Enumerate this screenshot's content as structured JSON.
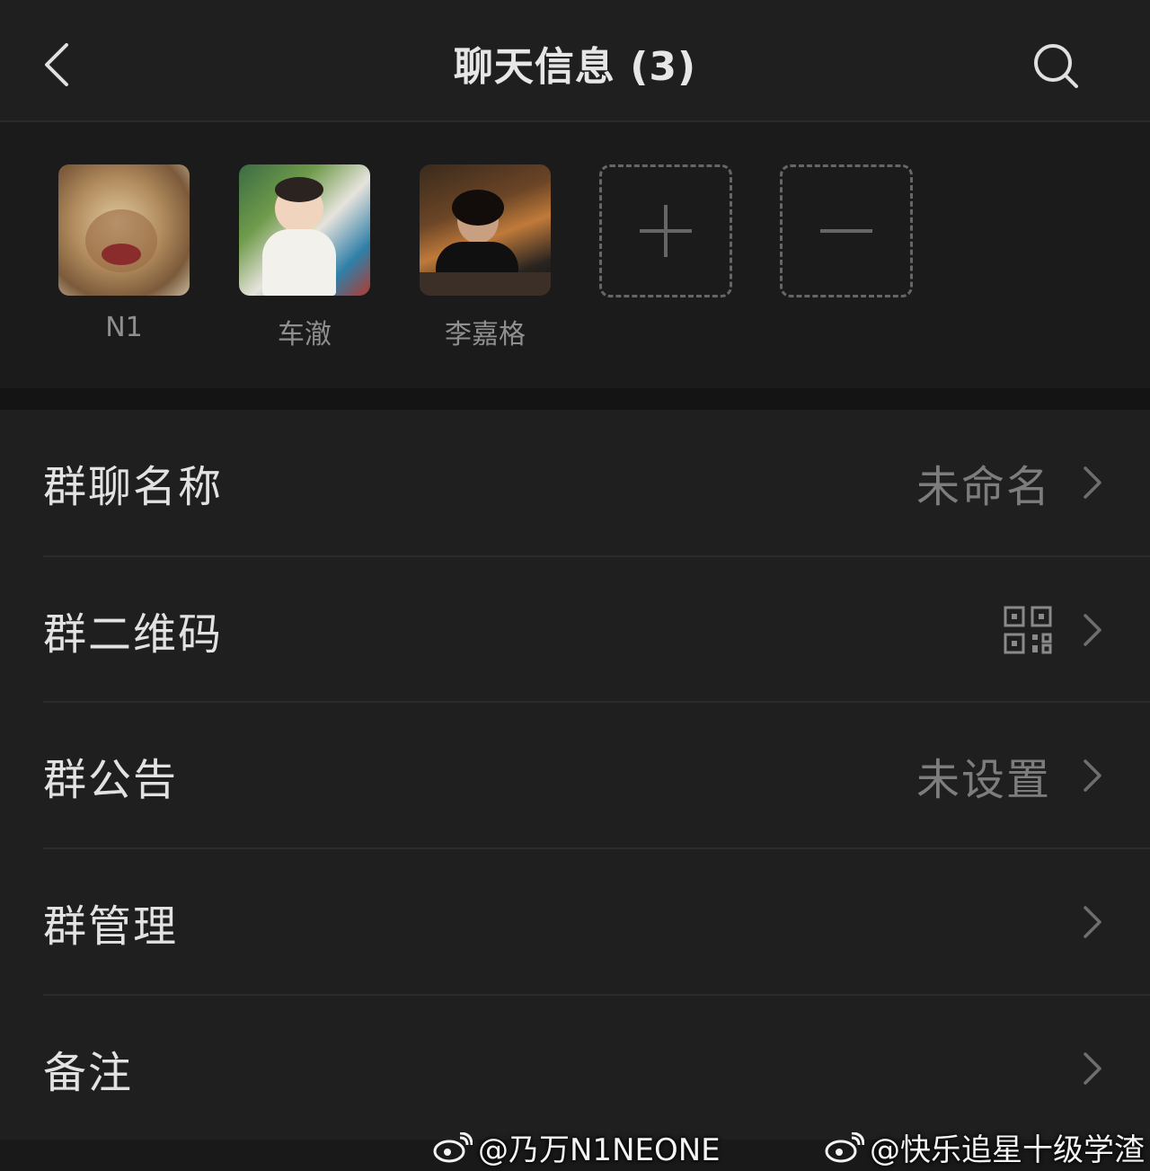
{
  "header": {
    "title": "聊天信息 (3)",
    "back_icon": "chevron-left-icon",
    "search_icon": "search-icon"
  },
  "members": [
    {
      "name": "N1"
    },
    {
      "name": "车澈"
    },
    {
      "name": "李嘉格"
    }
  ],
  "member_actions": {
    "add_icon": "plus-icon",
    "remove_icon": "minus-icon"
  },
  "settings": {
    "group_name": {
      "label": "群聊名称",
      "value": "未命名"
    },
    "qr_code": {
      "label": "群二维码",
      "icon": "qr-code-icon"
    },
    "announcement": {
      "label": "群公告",
      "value": "未设置"
    },
    "management": {
      "label": "群管理"
    },
    "remark": {
      "label": "备注"
    }
  },
  "watermarks": {
    "left": "@乃万N1NEONE",
    "right": "@快乐追星十级学渣"
  },
  "colors": {
    "background": "#1f1f1f",
    "text_primary": "#e2e2e2",
    "text_secondary": "#7d7d7d"
  }
}
